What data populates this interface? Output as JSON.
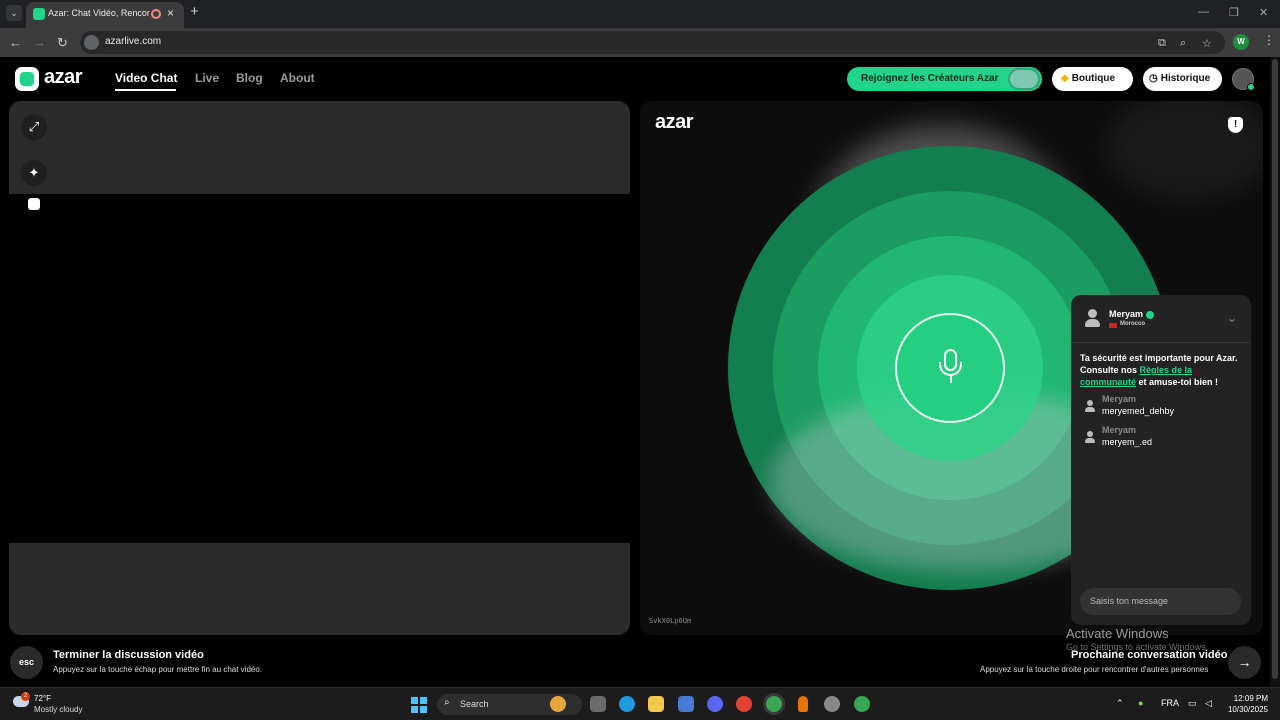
{
  "browser": {
    "tab_title": "Azar: Chat Vidéo, Rencontre",
    "url": "azarlive.com",
    "profile_initial": "W"
  },
  "header": {
    "logo": "azar",
    "nav": [
      "Video Chat",
      "Live",
      "Blog",
      "About"
    ],
    "creators_label": "Rejoignez les Créateurs Azar",
    "boutique_label": "Boutique",
    "historique_label": "Historique"
  },
  "right_panel": {
    "watermark": "azar",
    "session_id": "SvkX0Lp6Um"
  },
  "chat": {
    "partner_name": "Meryam",
    "partner_country": "Morocco",
    "safety_prefix": "Ta sécurité est importante pour Azar. Consulte nos ",
    "safety_link": "Règles de la communauté",
    "safety_suffix": " et amuse-toi bien !",
    "messages": [
      {
        "name": "Meryam",
        "text": "meryemed_dehby"
      },
      {
        "name": "Meryam",
        "text": "meryem_.ed"
      }
    ],
    "input_placeholder": "Saisis ton message"
  },
  "bottom": {
    "esc_label": "esc",
    "end_title": "Terminer la discussion vidéo",
    "end_sub": "Appuyez sur la touche échap pour mettre fin au chat vidéo.",
    "next_title": "Prochaine conversation vidéo",
    "next_sub": "Appuyez sur la touche droite pour rencontrer d'autres personnes",
    "activate_title": "Activate Windows",
    "activate_sub": "Go to Settings to activate Windows."
  },
  "taskbar": {
    "weather_badge": "2",
    "temperature": "72°F",
    "condition": "Mostly cloudy",
    "search_label": "Search",
    "language": "FRA",
    "time": "12:09 PM",
    "date": "10/30/2025"
  },
  "colors": {
    "accent": "#21d489",
    "panel": "#2b2b2b",
    "background": "#000000"
  }
}
